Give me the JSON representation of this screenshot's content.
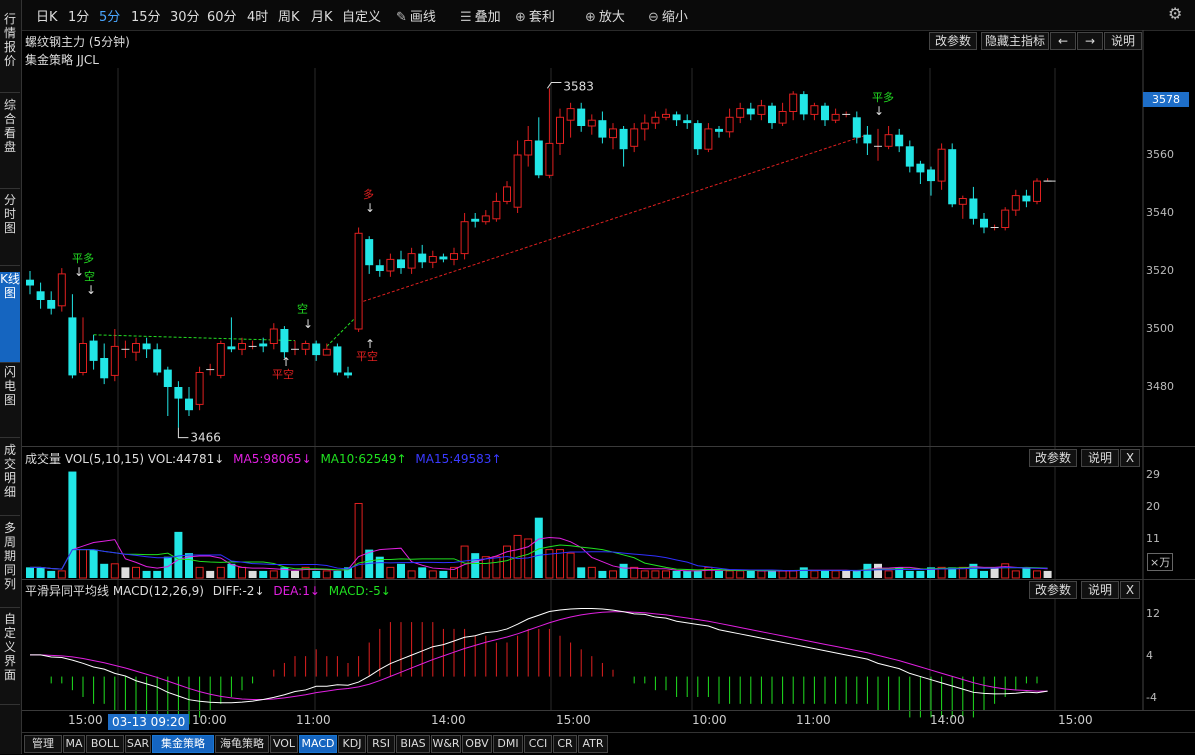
{
  "toolbar": {
    "periods": [
      "日K",
      "1分",
      "5分",
      "15分",
      "30分",
      "60分",
      "4时",
      "周K",
      "月K",
      "自定义"
    ],
    "active_period": "5分",
    "tools": [
      {
        "label": "画线",
        "icon": "pencil-icon"
      },
      {
        "label": "叠加",
        "icon": "stack-icon"
      },
      {
        "label": "套利",
        "icon": "arbitrage-icon"
      },
      {
        "label": "放大",
        "icon": "zoom-in-icon"
      },
      {
        "label": "缩小",
        "icon": "zoom-out-icon"
      }
    ],
    "settings_icon": "gear-icon"
  },
  "sidebar": {
    "tabs": [
      "行情报价",
      "综合看盘",
      "分时图",
      "K线图",
      "闪电图",
      "成交明细",
      "多周期同列",
      "自定义界面"
    ],
    "active": "K线图"
  },
  "main_panel": {
    "title": "螺纹钢主力 (5分钟)",
    "strategy": "集金策略 JJCL",
    "buttons": [
      "改参数",
      "隐藏主指标",
      "说明"
    ],
    "arrows": [
      "←",
      "→"
    ],
    "price_axis": [
      "3580",
      "3560",
      "3540",
      "3520",
      "3500",
      "3480"
    ],
    "current_price": "3578",
    "annotations": {
      "high_label": "3583",
      "low_label": "3466",
      "signals": [
        "平多",
        "空",
        "空",
        "平空",
        "多",
        "平空",
        "平多"
      ]
    }
  },
  "volume_panel": {
    "label": "成交量 VOL(5,10,15) VOL:44781↓",
    "ma5": "MA5:98065↓",
    "ma10": "MA10:62549↑",
    "ma15": "MA15:49583↑",
    "buttons": [
      "改参数",
      "说明",
      "X"
    ],
    "axis": [
      "29",
      "20",
      "11"
    ],
    "unit": "×万"
  },
  "macd_panel": {
    "label": "平滑异同平均线 MACD(12,26,9)",
    "diff": "DIFF:-2↓",
    "dea": "DEA:1↓",
    "macd": "MACD:-5↓",
    "buttons": [
      "改参数",
      "说明",
      "X"
    ],
    "axis": [
      "12",
      "4",
      "-4"
    ]
  },
  "time_axis": [
    "15:00",
    "10:00",
    "11:00",
    "14:00",
    "15:00",
    "10:00",
    "11:00",
    "14:00",
    "15:00"
  ],
  "cursor_time": "03-13 09:20",
  "bottom_tabs": [
    "管理",
    "MA",
    "BOLL",
    "SAR",
    "集金策略",
    "海龟策略",
    "VOL",
    "MACD",
    "KDJ",
    "RSI",
    "BIAS",
    "W&R",
    "OBV",
    "DMI",
    "CCI",
    "CR",
    "ATR"
  ],
  "active_tabs": [
    "集金策略",
    "MACD"
  ],
  "colors": {
    "up": "#e02020",
    "down": "#22e6e6",
    "ma5": "#e020e0",
    "ma10": "#20e020",
    "ma15": "#3030ff",
    "dea": "#e020e0",
    "diff": "#ffffff",
    "accent": "#1565c0"
  },
  "chart_data": {
    "type": "candlestick",
    "price_range": [
      3460,
      3590
    ],
    "candles": [
      [
        3517,
        3515,
        3520,
        3512
      ],
      [
        3513,
        3510,
        3516,
        3507
      ],
      [
        3510,
        3507,
        3513,
        3505
      ],
      [
        3508,
        3519,
        3521,
        3506
      ],
      [
        3504,
        3484,
        3512,
        3483
      ],
      [
        3485,
        3495,
        3504,
        3484
      ],
      [
        3496,
        3489,
        3498,
        3486
      ],
      [
        3490,
        3483,
        3495,
        3481
      ],
      [
        3484,
        3494,
        3500,
        3482
      ],
      [
        3493,
        3493,
        3496,
        3490
      ],
      [
        3492,
        3495,
        3497,
        3489
      ],
      [
        3495,
        3493,
        3497,
        3490
      ],
      [
        3493,
        3485,
        3495,
        3484
      ],
      [
        3486,
        3480,
        3487,
        3470
      ],
      [
        3480,
        3476,
        3482,
        3466
      ],
      [
        3476,
        3472,
        3480,
        3470
      ],
      [
        3474,
        3485,
        3487,
        3472
      ],
      [
        3486,
        3486,
        3488,
        3484
      ],
      [
        3484,
        3495,
        3496,
        3483
      ],
      [
        3494,
        3493,
        3504,
        3492
      ],
      [
        3493,
        3495,
        3497,
        3491
      ],
      [
        3494,
        3494,
        3496,
        3493
      ],
      [
        3495,
        3494,
        3497,
        3492
      ],
      [
        3495,
        3500,
        3502,
        3493
      ],
      [
        3500,
        3492,
        3501,
        3490
      ],
      [
        3493,
        3493,
        3496,
        3491
      ],
      [
        3493,
        3495,
        3496,
        3491
      ],
      [
        3495,
        3491,
        3496,
        3489
      ],
      [
        3491,
        3493,
        3495,
        3491
      ],
      [
        3494,
        3485,
        3495,
        3484
      ],
      [
        3485,
        3484,
        3487,
        3483
      ],
      [
        3500,
        3533,
        3535,
        3499
      ],
      [
        3531,
        3522,
        3532,
        3519
      ],
      [
        3522,
        3520,
        3524,
        3518
      ],
      [
        3520,
        3524,
        3526,
        3518
      ],
      [
        3524,
        3521,
        3527,
        3519
      ],
      [
        3521,
        3526,
        3528,
        3519
      ],
      [
        3526,
        3523,
        3529,
        3521
      ],
      [
        3523,
        3525,
        3527,
        3521
      ],
      [
        3525,
        3524,
        3526,
        3523
      ],
      [
        3524,
        3526,
        3528,
        3522
      ],
      [
        3526,
        3537,
        3540,
        3524
      ],
      [
        3538,
        3537,
        3540,
        3535
      ],
      [
        3537,
        3539,
        3541,
        3536
      ],
      [
        3538,
        3544,
        3547,
        3537
      ],
      [
        3544,
        3549,
        3551,
        3543
      ],
      [
        3542,
        3560,
        3565,
        3540
      ],
      [
        3560,
        3565,
        3570,
        3556
      ],
      [
        3565,
        3553,
        3573,
        3552
      ],
      [
        3553,
        3564,
        3583,
        3552
      ],
      [
        3564,
        3573,
        3576,
        3560
      ],
      [
        3572,
        3576,
        3578,
        3566
      ],
      [
        3576,
        3570,
        3578,
        3568
      ],
      [
        3570,
        3572,
        3574,
        3567
      ],
      [
        3572,
        3566,
        3575,
        3564
      ],
      [
        3566,
        3569,
        3571,
        3562
      ],
      [
        3569,
        3562,
        3570,
        3556
      ],
      [
        3563,
        3569,
        3571,
        3561
      ],
      [
        3569,
        3571,
        3574,
        3565
      ],
      [
        3571,
        3573,
        3575,
        3569
      ],
      [
        3573,
        3574,
        3576,
        3572
      ],
      [
        3574,
        3572,
        3575,
        3570
      ],
      [
        3572,
        3571,
        3574,
        3569
      ],
      [
        3571,
        3562,
        3572,
        3560
      ],
      [
        3562,
        3569,
        3571,
        3561
      ],
      [
        3569,
        3568,
        3570,
        3566
      ],
      [
        3568,
        3573,
        3576,
        3566
      ],
      [
        3573,
        3576,
        3578,
        3571
      ],
      [
        3576,
        3574,
        3578,
        3572
      ],
      [
        3574,
        3577,
        3579,
        3572
      ],
      [
        3577,
        3571,
        3578,
        3569
      ],
      [
        3571,
        3575,
        3578,
        3570
      ],
      [
        3575,
        3581,
        3582,
        3572
      ],
      [
        3581,
        3574,
        3582,
        3572
      ],
      [
        3574,
        3577,
        3578,
        3572
      ],
      [
        3577,
        3572,
        3578,
        3570
      ],
      [
        3572,
        3574,
        3576,
        3571
      ],
      [
        3574,
        3574,
        3575,
        3573
      ],
      [
        3573,
        3566,
        3575,
        3564
      ],
      [
        3567,
        3564,
        3570,
        3560
      ],
      [
        3563,
        3563,
        3569,
        3558
      ],
      [
        3563,
        3567,
        3570,
        3562
      ],
      [
        3567,
        3563,
        3569,
        3561
      ],
      [
        3563,
        3556,
        3565,
        3554
      ],
      [
        3557,
        3554,
        3558,
        3550
      ],
      [
        3555,
        3551,
        3556,
        3546
      ],
      [
        3551,
        3562,
        3564,
        3548
      ],
      [
        3562,
        3543,
        3564,
        3542
      ],
      [
        3543,
        3545,
        3546,
        3538
      ],
      [
        3545,
        3538,
        3549,
        3536
      ],
      [
        3538,
        3535,
        3540,
        3533
      ],
      [
        3535,
        3535,
        3536,
        3534
      ],
      [
        3535,
        3541,
        3542,
        3534
      ],
      [
        3541,
        3546,
        3548,
        3539
      ],
      [
        3546,
        3544,
        3548,
        3542
      ],
      [
        3544,
        3551,
        3552,
        3543
      ],
      [
        3551,
        3551,
        3552,
        3551
      ]
    ],
    "volume": [
      3,
      3,
      2,
      2,
      30,
      8,
      8,
      4,
      4,
      3,
      3,
      2,
      2,
      6,
      13,
      7,
      3,
      2,
      3,
      4,
      3,
      2,
      2,
      2,
      3,
      2,
      3,
      2,
      2,
      2,
      3,
      21,
      8,
      6,
      3,
      4,
      2,
      3,
      2,
      2,
      3,
      9,
      7,
      6,
      6,
      9,
      12,
      11,
      17,
      8,
      8,
      7,
      3,
      3,
      2,
      2,
      4,
      3,
      2,
      2,
      2,
      2,
      2,
      2,
      3,
      2,
      2,
      2,
      2,
      2,
      2,
      2,
      2,
      3,
      2,
      2,
      2,
      2,
      2,
      4,
      4,
      2,
      3,
      2,
      2,
      3,
      3,
      3,
      3,
      4,
      2,
      3,
      4,
      2,
      3,
      2,
      2
    ],
    "macd_hist": [
      0,
      0,
      -1,
      -1,
      -2,
      -3,
      -4,
      -4,
      -5,
      -5,
      -6,
      -6,
      -6,
      -7,
      -7,
      -7,
      -6,
      -5,
      -4,
      -3,
      -2,
      -1,
      0,
      1,
      2,
      3,
      3,
      4,
      3,
      3,
      2,
      3,
      5,
      7,
      8,
      8,
      8,
      8,
      8,
      7,
      7,
      7,
      6,
      6,
      5,
      5,
      6,
      7,
      7,
      7,
      6,
      5,
      4,
      3,
      2,
      1,
      0,
      -1,
      -1,
      -2,
      -2,
      -3,
      -3,
      -3,
      -3,
      -4,
      -4,
      -4,
      -4,
      -4,
      -4,
      -4,
      -4,
      -4,
      -4,
      -4,
      -4,
      -4,
      -4,
      -4,
      -5,
      -5,
      -5,
      -6,
      -6,
      -6,
      -6,
      -6,
      -6,
      -6,
      -5,
      -4,
      -3,
      -2,
      -1,
      -1,
      0
    ],
    "macd_range": [
      -6,
      15
    ]
  }
}
